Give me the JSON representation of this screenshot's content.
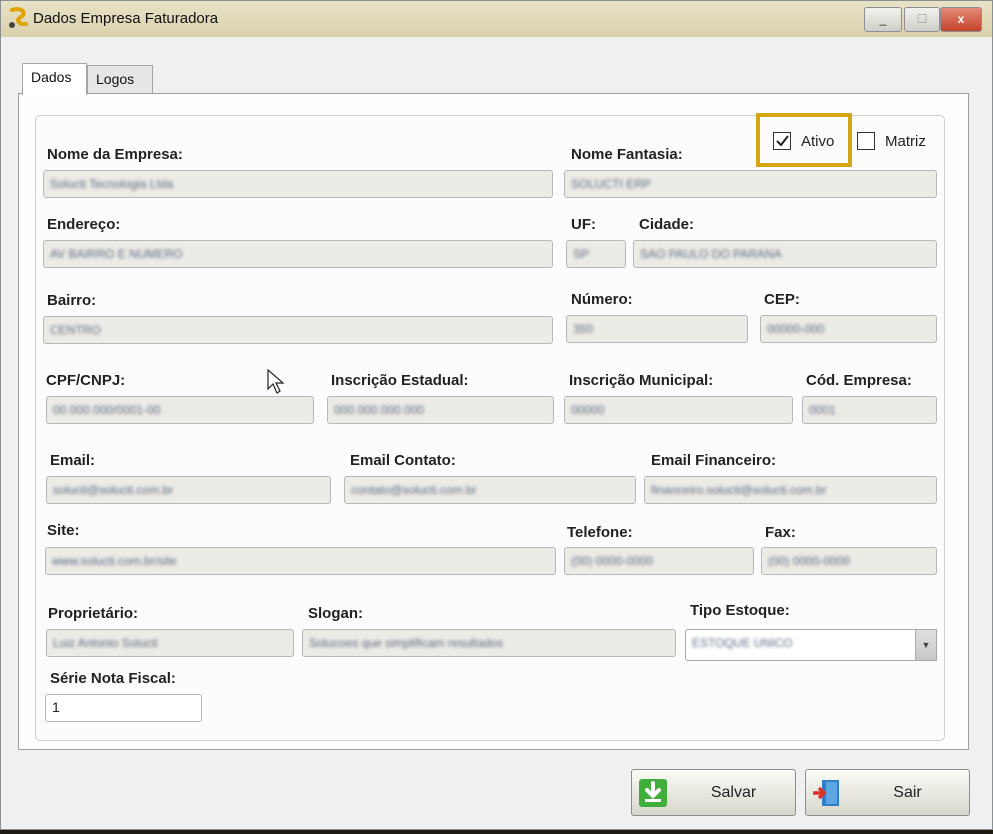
{
  "window": {
    "title": "Dados Empresa Faturadora",
    "min_label": "_",
    "max_label": "☐",
    "close_label": "x"
  },
  "tabs": [
    {
      "label": "Dados"
    },
    {
      "label": "Logos"
    }
  ],
  "checks": {
    "ativo": {
      "label": "Ativo",
      "checked": true
    },
    "matriz": {
      "label": "Matriz",
      "checked": false
    }
  },
  "labels": {
    "nome_empresa": "Nome da Empresa:",
    "nome_fantasia": "Nome Fantasia:",
    "endereco": "Endereço:",
    "uf": "UF:",
    "cidade": "Cidade:",
    "bairro": "Bairro:",
    "numero": "Número:",
    "cep": "CEP:",
    "cpf_cnpj": "CPF/CNPJ:",
    "inscricao_estadual": "Inscrição Estadual:",
    "inscricao_municipal": "Inscrição Municipal:",
    "cod_empresa": "Cód. Empresa:",
    "email": "Email:",
    "email_contato": "Email Contato:",
    "email_financeiro": "Email Financeiro:",
    "site": "Site:",
    "telefone": "Telefone:",
    "fax": "Fax:",
    "proprietario": "Proprietário:",
    "slogan": "Slogan:",
    "tipo_estoque": "Tipo Estoque:",
    "serie_nota_fiscal": "Série Nota Fiscal:"
  },
  "values": {
    "nome_empresa": "Solucti Tecnologia Ltda",
    "nome_fantasia": "SOLUCTI ERP",
    "endereco": "AV BAIRRO E NUMERO",
    "uf": "SP",
    "cidade": "SAO PAULO DO PARANA",
    "bairro": "CENTRO",
    "numero": "350",
    "cep": "00000-000",
    "cpf_cnpj": "00.000.000/0001-00",
    "inscricao_estadual": "000.000.000.000",
    "inscricao_municipal": "00000",
    "cod_empresa": "0001",
    "email": "solucti@solucti.com.br",
    "email_contato": "contato@solucti.com.br",
    "email_financeiro": "financeiro.solucti@solucti.com.br",
    "site": "www.solucti.com.br/site",
    "telefone": "(00) 0000-0000",
    "fax": "(00) 0000-0000",
    "proprietario": "Luiz Antonio Solucti",
    "slogan": "Solucoes que simplificam resultados",
    "tipo_estoque": "ESTOQUE UNICO",
    "serie_nota_fiscal": "1"
  },
  "buttons": {
    "salvar": "Salvar",
    "sair": "Sair"
  },
  "colors": {
    "highlight": "#d4a614",
    "salvar_icon": "#3fae3a",
    "sair_icon": "#2f7fc7"
  }
}
